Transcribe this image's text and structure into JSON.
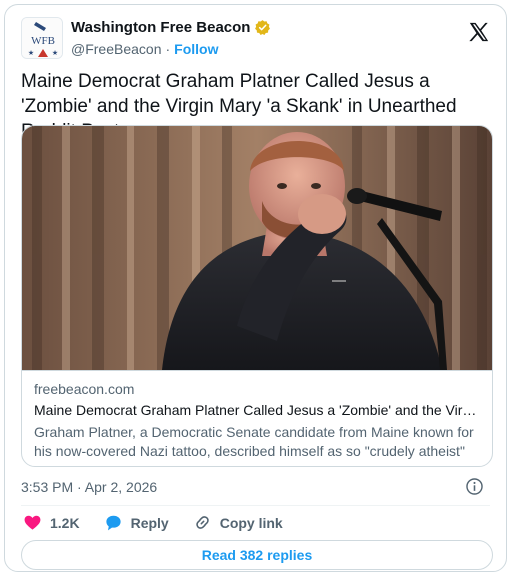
{
  "author": {
    "name": "Washington Free Beacon",
    "handle": "@FreeBeacon",
    "separator": "·",
    "follow_label": "Follow",
    "logo_text": "WFB",
    "verified_color": "#e2b719"
  },
  "tweet": {
    "text": "Maine Democrat Graham Platner Called Jesus a 'Zombie' and the Virgin Mary 'a Skank' in Unearthed Reddit Post",
    "timestamp": "3:53 PM · Apr 2, 2026"
  },
  "link_card": {
    "domain": "freebeacon.com",
    "title": "Maine Democrat Graham Platner Called Jesus a 'Zombie' and the Virgin ...",
    "description": "Graham Platner, a Democratic Senate candidate from Maine known for his now-covered Nazi tattoo, described himself as so \"crudely atheist\" ..."
  },
  "actions": {
    "like_count": "1.2K",
    "reply_label": "Reply",
    "copy_link_label": "Copy link"
  },
  "read_replies_label": "Read 382 replies",
  "colors": {
    "accent": "#1d9bf0",
    "like": "#f91880",
    "text": "#0f1419",
    "muted": "#536471"
  },
  "icons": [
    "verified-badge-icon",
    "x-logo-icon",
    "info-icon",
    "heart-icon",
    "reply-bubble-icon",
    "link-icon"
  ]
}
